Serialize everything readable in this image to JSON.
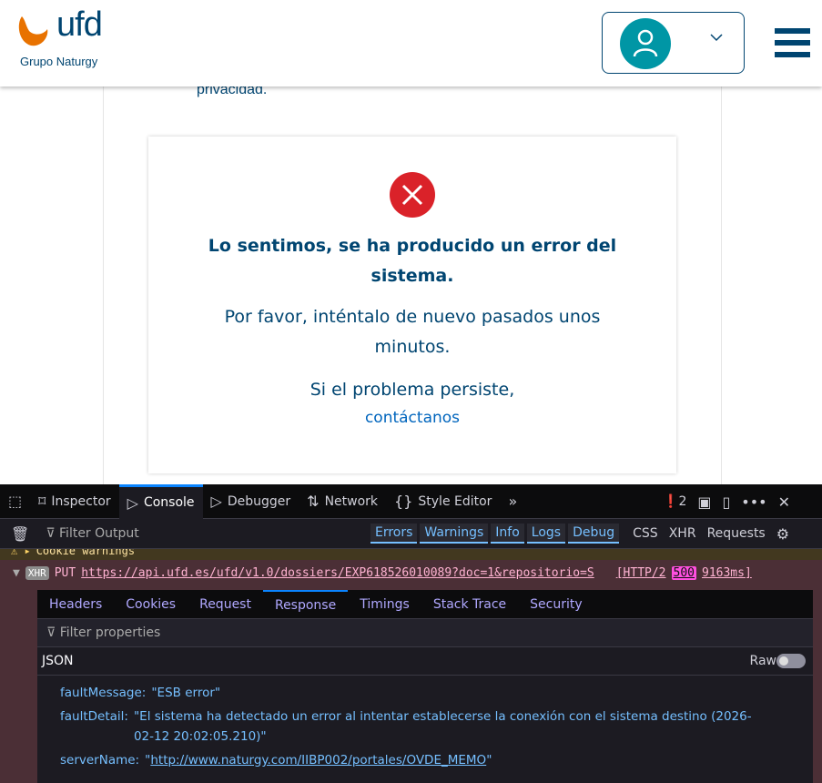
{
  "header": {
    "logo_text": "ufd",
    "logo_sub": "Grupo Naturgy",
    "brand_orange": "#e87200",
    "brand_blue": "#004571"
  },
  "page": {
    "privacy_tail": "privacidad."
  },
  "error_card": {
    "title": "Lo sentimos, se ha producido un error del sistema.",
    "retry": "Por favor, inténtalo de nuevo pasados unos minutos.",
    "persist": "Si el problema persiste,",
    "contact_link": "contáctanos"
  },
  "devtools": {
    "tools": [
      "Inspector",
      "Console",
      "Debugger",
      "Network",
      "Style Editor"
    ],
    "error_count": "2",
    "filter_placeholder": "Filter Output",
    "levels": [
      "Errors",
      "Warnings",
      "Info",
      "Logs",
      "Debug"
    ],
    "extra_filters": [
      "CSS",
      "XHR",
      "Requests"
    ],
    "cookie_row": "Cookie warnings",
    "request": {
      "badge": "XHR",
      "method": "PUT",
      "url": "https://api.ufd.es/ufd/v1.0/dossiers/EXP618526010089?doc=1&repositorio=S",
      "protocol": "[HTTP/2",
      "status": "500",
      "time": "9163ms]"
    },
    "panel_tabs": [
      "Headers",
      "Cookies",
      "Request",
      "Response",
      "Timings",
      "Stack Trace",
      "Security"
    ],
    "filter_properties": "Filter properties",
    "json_label": "JSON",
    "raw_label": "Raw",
    "props": [
      {
        "key": "faultMessage:",
        "value": "\"ESB error\""
      },
      {
        "key": "faultDetail:",
        "value": "\"El sistema ha detectado un error al intentar establecerse la conexión con el sistema destino (2026-02-12 20:02:05.210)\""
      },
      {
        "key": "serverName:",
        "value_prefix": "\"",
        "link": "http://www.naturgy.com/IIBP002/portales/OVDE_MEMO",
        "value_suffix": "\""
      }
    ]
  }
}
